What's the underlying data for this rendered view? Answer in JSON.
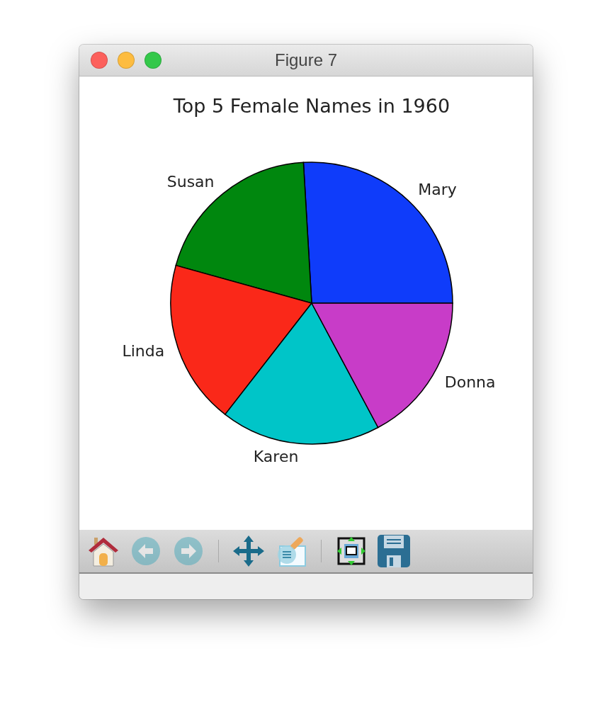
{
  "window": {
    "title": "Figure 7"
  },
  "figure": {
    "chart_data": {
      "type": "pie",
      "title": "Top 5 Female Names in 1960",
      "categories": [
        "Mary",
        "Susan",
        "Linda",
        "Karen",
        "Donna"
      ],
      "values": [
        25.93,
        19.75,
        18.8,
        18.33,
        17.19
      ],
      "colors": [
        "#0f3cfa",
        "#00870e",
        "#fa2819",
        "#00c5c8",
        "#c83cc8"
      ]
    }
  },
  "toolbar": [
    {
      "kind": "home",
      "disabled": false
    },
    {
      "kind": "back",
      "disabled": true
    },
    {
      "kind": "forward",
      "disabled": true
    },
    {
      "kind": "separator"
    },
    {
      "kind": "pan",
      "disabled": false
    },
    {
      "kind": "zoom",
      "disabled": false
    },
    {
      "kind": "separator"
    },
    {
      "kind": "configure",
      "disabled": false
    },
    {
      "kind": "save",
      "disabled": false
    }
  ]
}
